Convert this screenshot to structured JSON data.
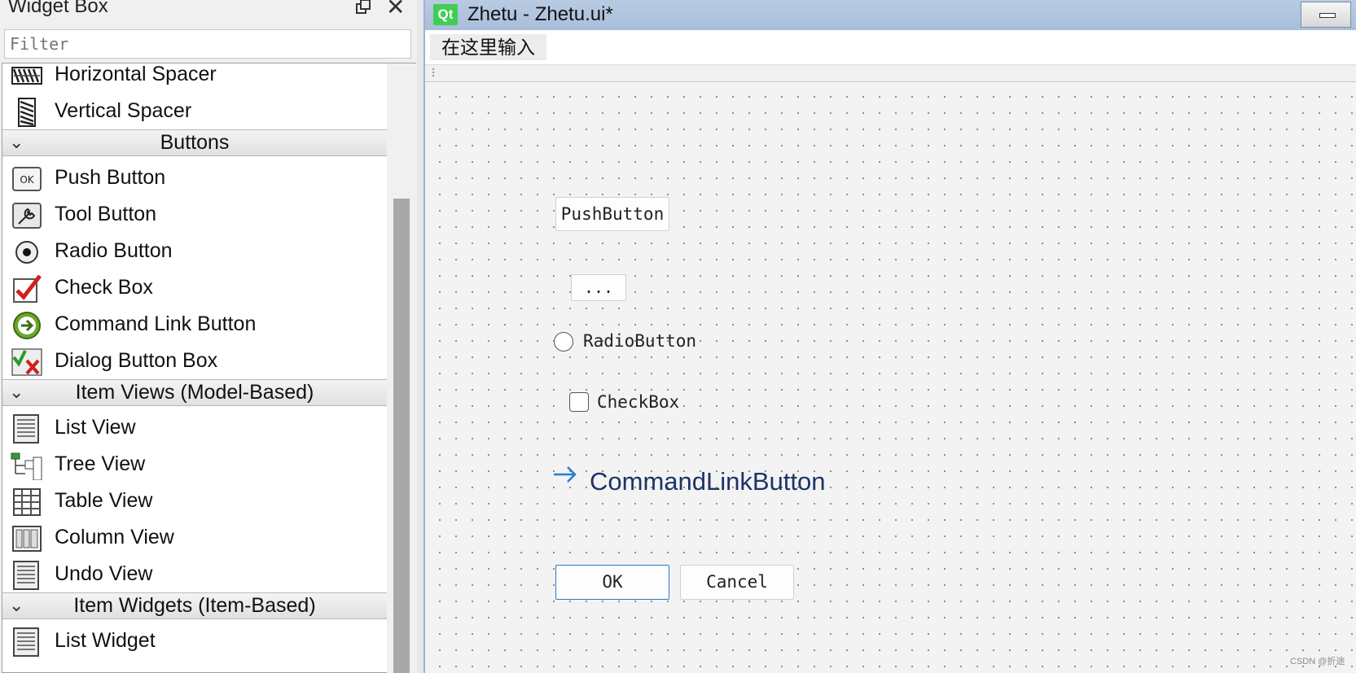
{
  "widget_box": {
    "title": "Widget Box",
    "filter_placeholder": "Filter",
    "rows": [
      {
        "kind": "item",
        "label": "Horizontal Spacer",
        "icon": "horizontal-spacer-icon"
      },
      {
        "kind": "item",
        "label": "Vertical Spacer",
        "icon": "vertical-spacer-icon"
      },
      {
        "kind": "category",
        "label": "Buttons"
      },
      {
        "kind": "item",
        "label": "Push Button",
        "icon": "push-button-icon"
      },
      {
        "kind": "item",
        "label": "Tool Button",
        "icon": "tool-button-icon"
      },
      {
        "kind": "item",
        "label": "Radio Button",
        "icon": "radio-button-icon"
      },
      {
        "kind": "item",
        "label": "Check Box",
        "icon": "check-box-icon"
      },
      {
        "kind": "item",
        "label": "Command Link Button",
        "icon": "command-link-button-icon"
      },
      {
        "kind": "item",
        "label": "Dialog Button Box",
        "icon": "dialog-button-box-icon"
      },
      {
        "kind": "category",
        "label": "Item Views (Model-Based)"
      },
      {
        "kind": "item",
        "label": "List View",
        "icon": "list-view-icon"
      },
      {
        "kind": "item",
        "label": "Tree View",
        "icon": "tree-view-icon"
      },
      {
        "kind": "item",
        "label": "Table View",
        "icon": "table-view-icon"
      },
      {
        "kind": "item",
        "label": "Column View",
        "icon": "column-view-icon"
      },
      {
        "kind": "item",
        "label": "Undo View",
        "icon": "undo-view-icon"
      },
      {
        "kind": "category",
        "label": "Item Widgets (Item-Based)"
      },
      {
        "kind": "item",
        "label": "List Widget",
        "icon": "list-widget-icon"
      }
    ]
  },
  "form_window": {
    "logo_text": "Qt",
    "title": "Zhetu - Zhetu.ui*",
    "menu_placeholder": "在这里输入",
    "widgets": {
      "push_button": "PushButton",
      "tool_button": "...",
      "radio_button": "RadioButton",
      "check_box": "CheckBox",
      "command_link_button": "CommandLinkButton",
      "ok_button": "OK",
      "cancel_button": "Cancel"
    }
  },
  "colors": {
    "qt_green": "#41cd52",
    "command_link_blue": "#1c3466",
    "focus_blue": "#2a7bd0"
  },
  "watermark": "CSDN @折途"
}
